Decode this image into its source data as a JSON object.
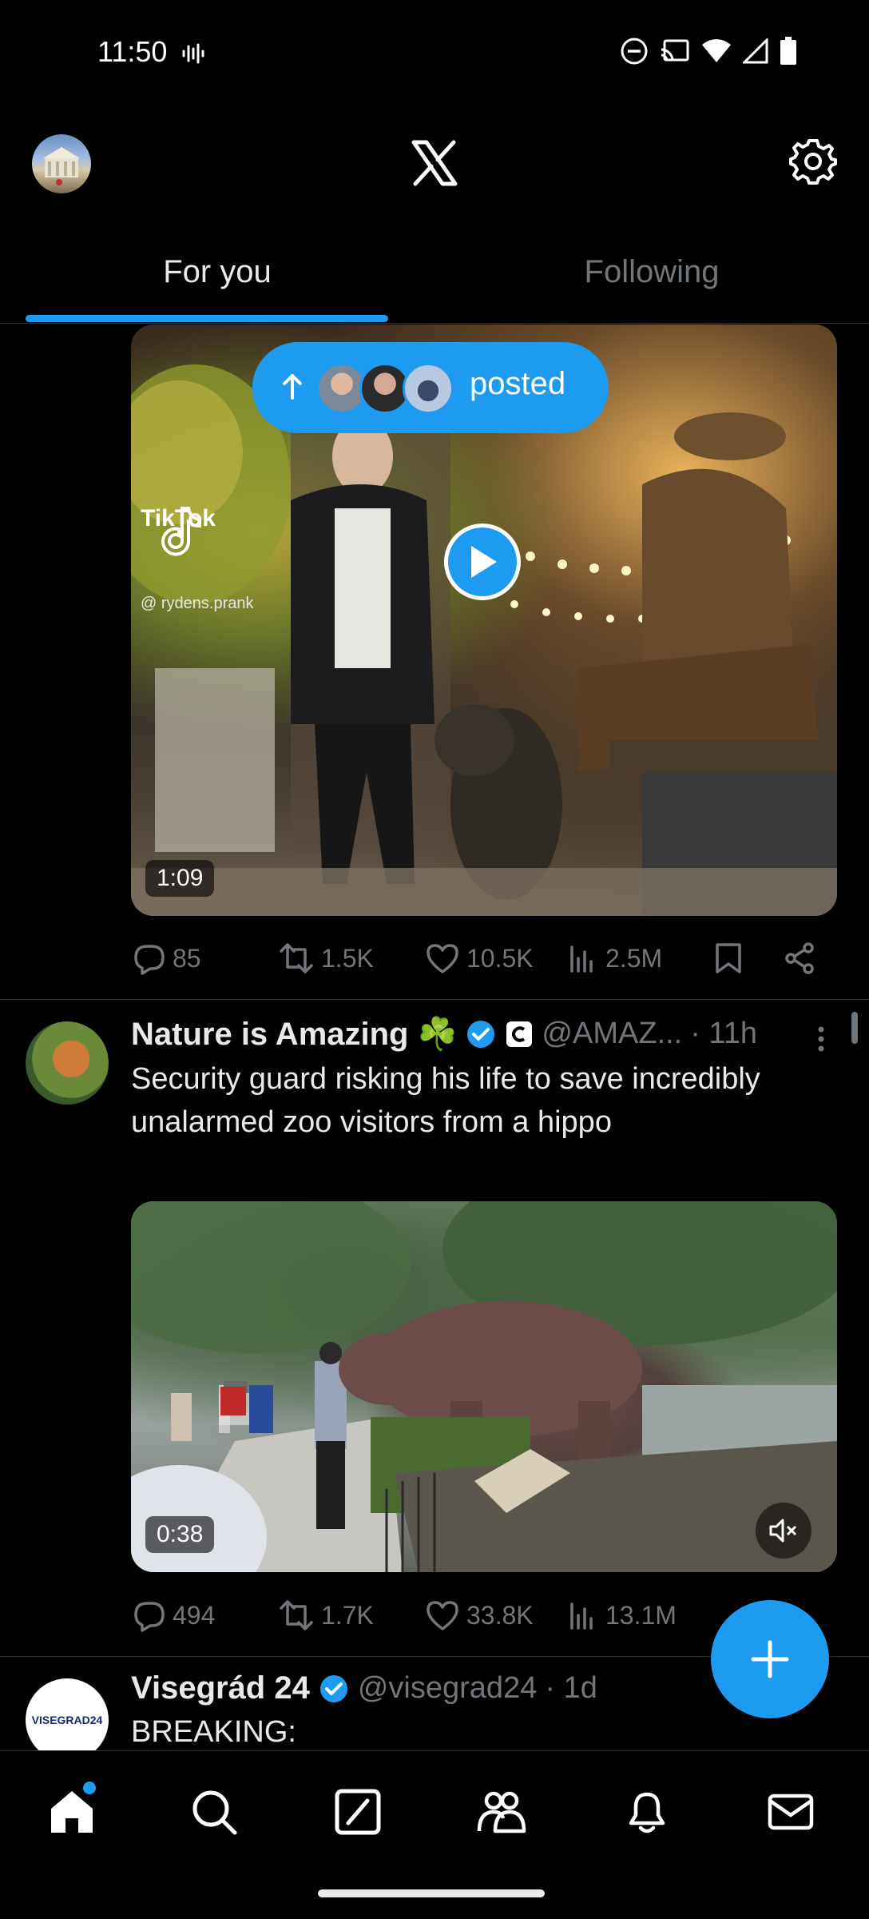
{
  "status_bar": {
    "time": "11:50"
  },
  "header": {
    "logo": "x-logo-icon",
    "settings": "gear-icon"
  },
  "tabs": [
    {
      "label": "For you",
      "active": true
    },
    {
      "label": "Following",
      "active": false
    }
  ],
  "posted_pill": {
    "label": "posted"
  },
  "tweet1": {
    "media_duration": "1:09",
    "watermark": "TikTok",
    "watermark_handle": "@ rydens.prank",
    "stats": {
      "replies": "85",
      "reposts": "1.5K",
      "likes": "10.5K",
      "views": "2.5M"
    }
  },
  "tweet2": {
    "name": "Nature is Amazing ☘️",
    "handle": "@AMAZ...",
    "time": "· 11h",
    "text": "Security guard risking his life to save incredibly unalarmed zoo visitors from a hippo",
    "media_duration": "0:38",
    "stats": {
      "replies": "494",
      "reposts": "1.7K",
      "likes": "33.8K",
      "views": "13.1M"
    }
  },
  "tweet3": {
    "name": "Visegrád 24",
    "avatar_text": "VISEGRAD24",
    "handle": "@visegrad24",
    "time": "· 1d",
    "text": "BREAKING:"
  },
  "colors": {
    "accent": "#1d9bf0",
    "background": "#000000",
    "muted": "#71767b"
  }
}
